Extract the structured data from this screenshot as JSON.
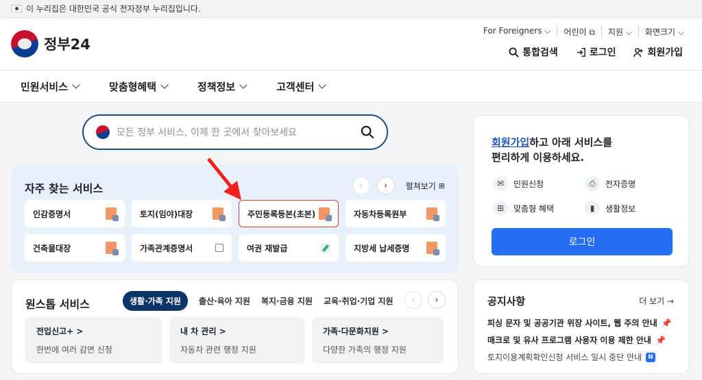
{
  "notice": {
    "text": "이 누리집은 대한민국 공식 전자정부 누리집입니다."
  },
  "header": {
    "logo_text": "정부24",
    "util": [
      "For Foreigners ⌵",
      "어린이 ⧉",
      "지원 ⌵",
      "화면크기 ⌵"
    ],
    "actions": {
      "search": "통합검색",
      "login": "로그인",
      "signup": "회원가입"
    }
  },
  "gnb": [
    "민원서비스",
    "맞춤형혜택",
    "정책정보",
    "고객센터"
  ],
  "search": {
    "placeholder": "모든 정부 서비스, 이제 한 곳에서 찾아보세요"
  },
  "frequent": {
    "title": "자주 찾는 서비스",
    "expand": "펼쳐보기",
    "items": [
      "인감증명서",
      "토지(임야)대장",
      "주민등록등본(초본)",
      "자동차등록원부",
      "건축물대장",
      "가족관계증명서",
      "여권 재발급",
      "지방세 납세증명"
    ]
  },
  "onestop": {
    "title": "원스톱 서비스",
    "tabs": [
      "생활·가족 지원",
      "출산·육아 지원",
      "복지·금융 지원",
      "교육·취업·기업 지원"
    ],
    "cards": [
      {
        "title": "전입신고+ >",
        "desc": "한번에 여러 감면 신청"
      },
      {
        "title": "내 차 관리 >",
        "desc": "자동차 관련 행정 지원"
      },
      {
        "title": "가족·다문화지원 >",
        "desc": "다양한 가족의 행정 지원"
      }
    ]
  },
  "member": {
    "link": "회원가입",
    "line1_rest": "하고 아래 서비스를",
    "line2": "편리하게 이용하세요.",
    "items": [
      "민원신청",
      "전자증명",
      "맞춤형 혜택",
      "생활정보"
    ],
    "login": "로그인"
  },
  "notices": {
    "title": "공지사항",
    "more": "더 보기 →",
    "items": [
      "피싱 문자 및 공공기관 위장 사이트, 웹 주의 안내",
      "매크로 및 유사 프로그램 사용자 이용 제한 안내",
      "토지이용계획확인신청 서비스 일시 중단 안내"
    ],
    "badge": "N"
  },
  "colors": {
    "primary": "#256ef4",
    "navy": "#0b3468",
    "highlight": "#e0373a"
  }
}
